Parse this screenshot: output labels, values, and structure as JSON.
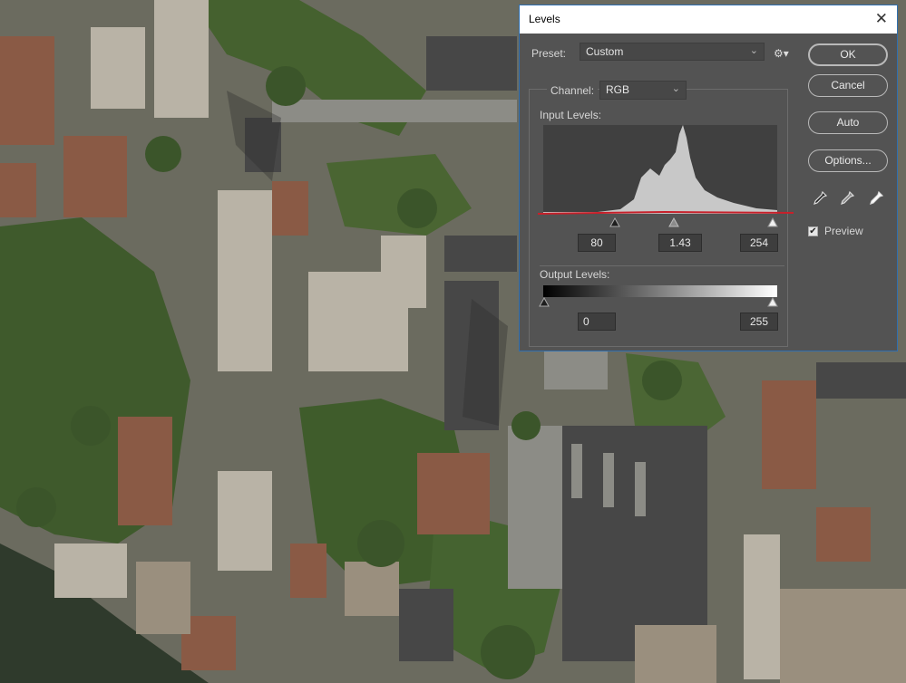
{
  "dialog": {
    "title": "Levels",
    "close_glyph": "✕",
    "preset_label": "Preset:",
    "preset_value": "Custom",
    "channel_label": "Channel:",
    "channel_value": "RGB",
    "input_levels_label": "Input Levels:",
    "input_black": "80",
    "input_gamma": "1.43",
    "input_white": "254",
    "output_levels_label": "Output Levels:",
    "output_black": "0",
    "output_white": "255",
    "buttons": {
      "ok": "OK",
      "cancel": "Cancel",
      "auto": "Auto",
      "options": "Options..."
    },
    "preview_label": "Preview",
    "preview_checked": true
  },
  "icons": {
    "gear": "gear-icon",
    "eyedroppers": [
      "black-point-eyedropper-icon",
      "gray-point-eyedropper-icon",
      "white-point-eyedropper-icon"
    ]
  },
  "colors": {
    "dialog_bg": "#535353",
    "clip_line": "#c8202a",
    "histogram": "#c8c8c8"
  }
}
